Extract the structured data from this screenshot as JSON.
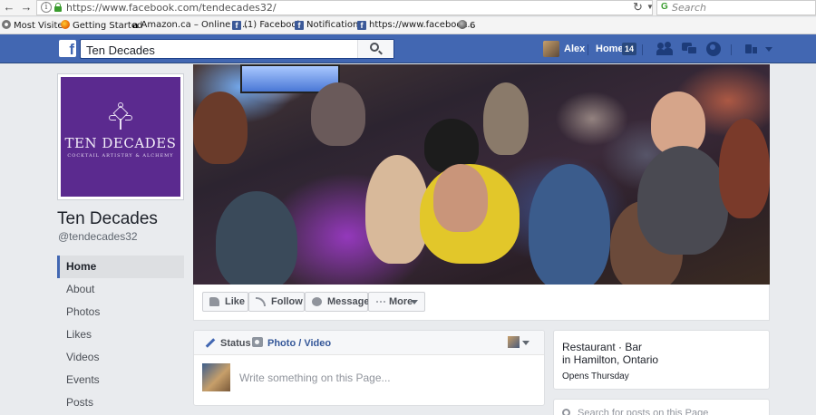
{
  "browser": {
    "url": "https://www.facebook.com/tendecades32/",
    "search_placeholder": "Search",
    "bookmarks": [
      {
        "label": "Most Visited",
        "icon": "gear-icon"
      },
      {
        "label": "Getting Started",
        "icon": "firefox-icon"
      },
      {
        "label": "Amazon.ca – Online S...",
        "icon": "amazon-icon"
      },
      {
        "label": "(1) Facebook",
        "icon": "facebook-icon"
      },
      {
        "label": "Notifications",
        "icon": "facebook-icon"
      },
      {
        "label": "https://www.facebook...",
        "icon": "facebook-icon"
      },
      {
        "label": "6",
        "icon": "globe-icon"
      }
    ]
  },
  "fbbar": {
    "search_value": "Ten Decades",
    "user_name": "Alex",
    "home_label": "Home",
    "home_count": "14",
    "color": "#4267b2"
  },
  "profile": {
    "logo_title": "TEN DECADES",
    "logo_subtitle": "COCKTAIL ARTISTRY & ALCHEMY",
    "page_name": "Ten Decades",
    "handle": "@tendecades32"
  },
  "leftnav": [
    {
      "label": "Home",
      "active": true
    },
    {
      "label": "About"
    },
    {
      "label": "Photos"
    },
    {
      "label": "Likes"
    },
    {
      "label": "Videos"
    },
    {
      "label": "Events"
    },
    {
      "label": "Posts"
    }
  ],
  "actions": {
    "like": "Like",
    "follow": "Follow",
    "message": "Message",
    "more": "More"
  },
  "composer": {
    "status_tab": "Status",
    "photo_tab": "Photo / Video",
    "placeholder": "Write something on this Page..."
  },
  "info": {
    "category": "Restaurant · Bar",
    "location": "in Hamilton, Ontario",
    "hours": "Opens Thursday"
  },
  "post_search": {
    "placeholder": "Search for posts on this Page"
  }
}
